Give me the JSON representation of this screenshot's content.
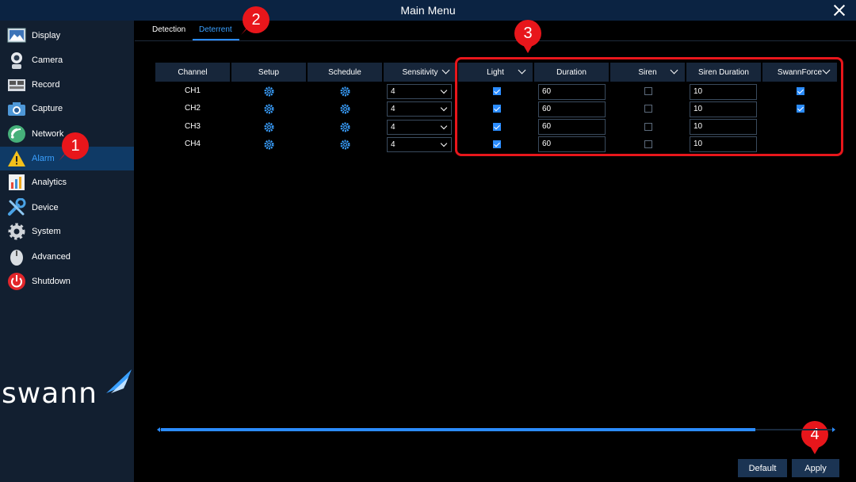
{
  "window": {
    "title": "Main Menu"
  },
  "sidebar": {
    "items": [
      {
        "label": "Display",
        "icon": "display-icon"
      },
      {
        "label": "Camera",
        "icon": "camera-icon"
      },
      {
        "label": "Record",
        "icon": "record-icon"
      },
      {
        "label": "Capture",
        "icon": "capture-icon"
      },
      {
        "label": "Network",
        "icon": "network-icon"
      },
      {
        "label": "Alarm",
        "icon": "alarm-icon",
        "active": true
      },
      {
        "label": "Analytics",
        "icon": "analytics-icon"
      },
      {
        "label": "Device",
        "icon": "device-icon"
      },
      {
        "label": "System",
        "icon": "system-icon"
      },
      {
        "label": "Advanced",
        "icon": "advanced-icon"
      },
      {
        "label": "Shutdown",
        "icon": "shutdown-icon"
      }
    ],
    "logo_text": "swann"
  },
  "tabs": [
    {
      "label": "Detection"
    },
    {
      "label": "Deterrent",
      "active": true
    }
  ],
  "table": {
    "headers": [
      "Channel",
      "Setup",
      "Schedule",
      "Sensitivity",
      "Light",
      "Duration",
      "Siren",
      "Siren Duration",
      "SwannForce"
    ],
    "rows": [
      {
        "channel": "CH1",
        "sensitivity": "4",
        "light": true,
        "duration": "60",
        "siren": false,
        "siren_duration": "10",
        "swannforce": true
      },
      {
        "channel": "CH2",
        "sensitivity": "4",
        "light": true,
        "duration": "60",
        "siren": false,
        "siren_duration": "10",
        "swannforce": true
      },
      {
        "channel": "CH3",
        "sensitivity": "4",
        "light": true,
        "duration": "60",
        "siren": false,
        "siren_duration": "10",
        "swannforce": null
      },
      {
        "channel": "CH4",
        "sensitivity": "4",
        "light": true,
        "duration": "60",
        "siren": false,
        "siren_duration": "10",
        "swannforce": null
      }
    ]
  },
  "markers": [
    "1",
    "2",
    "3",
    "4"
  ],
  "footer": {
    "default_label": "Default",
    "apply_label": "Apply"
  },
  "colors": {
    "accent": "#2b8cff",
    "highlight": "#e8161b",
    "title_bar": "#0b2342"
  }
}
